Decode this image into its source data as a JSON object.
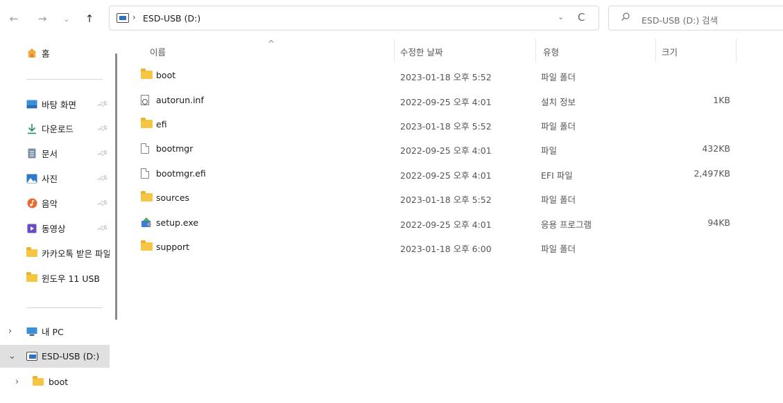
{
  "nav": {
    "back": "←",
    "forward": "→",
    "recent": "⌄",
    "up": "↑"
  },
  "address": {
    "separator": "›",
    "path": "ESD-USB (D:)",
    "dropdown": "⌄",
    "refresh": "C"
  },
  "search": {
    "placeholder": "ESD-USB (D:) 검색"
  },
  "sidebar": {
    "home": "홈",
    "pinned": [
      {
        "label": "바탕 화면",
        "icon": "desktop-icon",
        "pinned": true
      },
      {
        "label": "다운로드",
        "icon": "download-icon",
        "pinned": true
      },
      {
        "label": "문서",
        "icon": "documents-icon",
        "pinned": true
      },
      {
        "label": "사진",
        "icon": "pictures-icon",
        "pinned": true
      },
      {
        "label": "음악",
        "icon": "music-icon",
        "pinned": true
      },
      {
        "label": "동영상",
        "icon": "videos-icon",
        "pinned": true
      },
      {
        "label": "카카오톡 받은 파일",
        "icon": "folder-icon",
        "pinned": false
      },
      {
        "label": "윈도우 11 USB",
        "icon": "folder-icon",
        "pinned": false
      }
    ],
    "tree": [
      {
        "label": "내 PC",
        "icon": "pc-icon",
        "chevron": "›"
      },
      {
        "label": "ESD-USB (D:)",
        "icon": "usb-drive-icon",
        "chevron": "⌄",
        "selected": true
      },
      {
        "label": "boot",
        "icon": "folder-icon",
        "chevron": "›"
      }
    ]
  },
  "columns": {
    "name": "이름",
    "date": "수정한 날짜",
    "type": "유형",
    "size": "크기",
    "sort_indicator": "^"
  },
  "files": [
    {
      "name": "boot",
      "date": "2023-01-18 오후 5:52",
      "type": "파일 폴더",
      "size": "",
      "icon": "folder-icon"
    },
    {
      "name": "autorun.inf",
      "date": "2022-09-25 오후 4:01",
      "type": "설치 정보",
      "size": "1KB",
      "icon": "setup-info-icon"
    },
    {
      "name": "efi",
      "date": "2023-01-18 오후 5:52",
      "type": "파일 폴더",
      "size": "",
      "icon": "folder-icon"
    },
    {
      "name": "bootmgr",
      "date": "2022-09-25 오후 4:01",
      "type": "파일",
      "size": "432KB",
      "icon": "file-icon"
    },
    {
      "name": "bootmgr.efi",
      "date": "2022-09-25 오후 4:01",
      "type": "EFI 파일",
      "size": "2,497KB",
      "icon": "file-icon"
    },
    {
      "name": "sources",
      "date": "2023-01-18 오후 5:52",
      "type": "파일 폴더",
      "size": "",
      "icon": "folder-icon"
    },
    {
      "name": "setup.exe",
      "date": "2022-09-25 오후 4:01",
      "type": "응용 프로그램",
      "size": "94KB",
      "icon": "setup-exe-icon"
    },
    {
      "name": "support",
      "date": "2023-01-18 오후 6:00",
      "type": "파일 폴더",
      "size": "",
      "icon": "folder-icon"
    }
  ],
  "colors": {
    "folder": "#f6c544",
    "accent": "#2f6fc4",
    "selected_bg": "#e0e0e0"
  }
}
